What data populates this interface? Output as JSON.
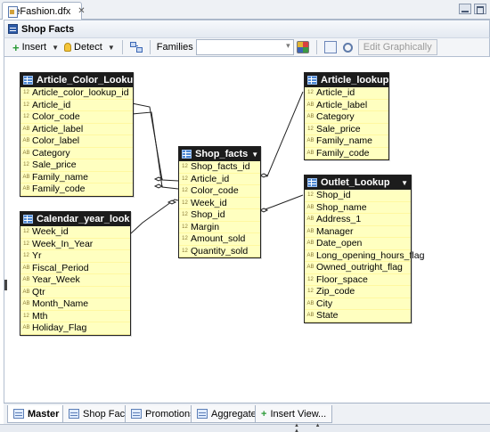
{
  "editor_tab": {
    "title": "*eFashion.dfx"
  },
  "panel": {
    "title": "Shop Facts"
  },
  "toolbar": {
    "insert_label": "Insert",
    "detect_label": "Detect",
    "families_label": "Families",
    "families_value": "",
    "edit_graphically_label": "Edit Graphically"
  },
  "tables": {
    "article_color_lookup": {
      "name": "Article_Color_Lookup",
      "columns": [
        {
          "type": "12",
          "name": "Article_color_lookup_id"
        },
        {
          "type": "12",
          "name": "Article_id"
        },
        {
          "type": "12",
          "name": "Color_code"
        },
        {
          "type": "AB",
          "name": "Article_label"
        },
        {
          "type": "AB",
          "name": "Color_label"
        },
        {
          "type": "AB",
          "name": "Category"
        },
        {
          "type": "12",
          "name": "Sale_price"
        },
        {
          "type": "AB",
          "name": "Family_name"
        },
        {
          "type": "AB",
          "name": "Family_code"
        }
      ]
    },
    "article_lookup": {
      "name": "Article_lookup",
      "columns": [
        {
          "type": "12",
          "name": "Article_id"
        },
        {
          "type": "AB",
          "name": "Article_label"
        },
        {
          "type": "AB",
          "name": "Category"
        },
        {
          "type": "12",
          "name": "Sale_price"
        },
        {
          "type": "AB",
          "name": "Family_name"
        },
        {
          "type": "AB",
          "name": "Family_code"
        }
      ]
    },
    "shop_facts": {
      "name": "Shop_facts",
      "columns": [
        {
          "type": "12",
          "name": "Shop_facts_id"
        },
        {
          "type": "12",
          "name": "Article_id"
        },
        {
          "type": "12",
          "name": "Color_code"
        },
        {
          "type": "12",
          "name": "Week_id"
        },
        {
          "type": "12",
          "name": "Shop_id"
        },
        {
          "type": "12",
          "name": "Margin"
        },
        {
          "type": "12",
          "name": "Amount_sold"
        },
        {
          "type": "12",
          "name": "Quantity_sold"
        }
      ]
    },
    "calendar_year_lookup": {
      "name": "Calendar_year_lookup",
      "columns": [
        {
          "type": "12",
          "name": "Week_id"
        },
        {
          "type": "12",
          "name": "Week_In_Year"
        },
        {
          "type": "12",
          "name": "Yr"
        },
        {
          "type": "AB",
          "name": "Fiscal_Period"
        },
        {
          "type": "AB",
          "name": "Year_Week"
        },
        {
          "type": "AB",
          "name": "Qtr"
        },
        {
          "type": "AB",
          "name": "Month_Name"
        },
        {
          "type": "12",
          "name": "Mth"
        },
        {
          "type": "AB",
          "name": "Holiday_Flag"
        }
      ]
    },
    "outlet_lookup": {
      "name": "Outlet_Lookup",
      "columns": [
        {
          "type": "12",
          "name": "Shop_id"
        },
        {
          "type": "AB",
          "name": "Shop_name"
        },
        {
          "type": "AB",
          "name": "Address_1"
        },
        {
          "type": "AB",
          "name": "Manager"
        },
        {
          "type": "AB",
          "name": "Date_open"
        },
        {
          "type": "AB",
          "name": "Long_opening_hours_flag"
        },
        {
          "type": "AB",
          "name": "Owned_outright_flag"
        },
        {
          "type": "12",
          "name": "Floor_space"
        },
        {
          "type": "12",
          "name": "Zip_code"
        },
        {
          "type": "AB",
          "name": "City"
        },
        {
          "type": "AB",
          "name": "State"
        }
      ]
    }
  },
  "bottom_tabs": {
    "master": "Master",
    "shop_facts": "Shop Facts",
    "promotions": "Promotions",
    "aggregates": "Aggregates",
    "insert_view": "Insert View..."
  }
}
